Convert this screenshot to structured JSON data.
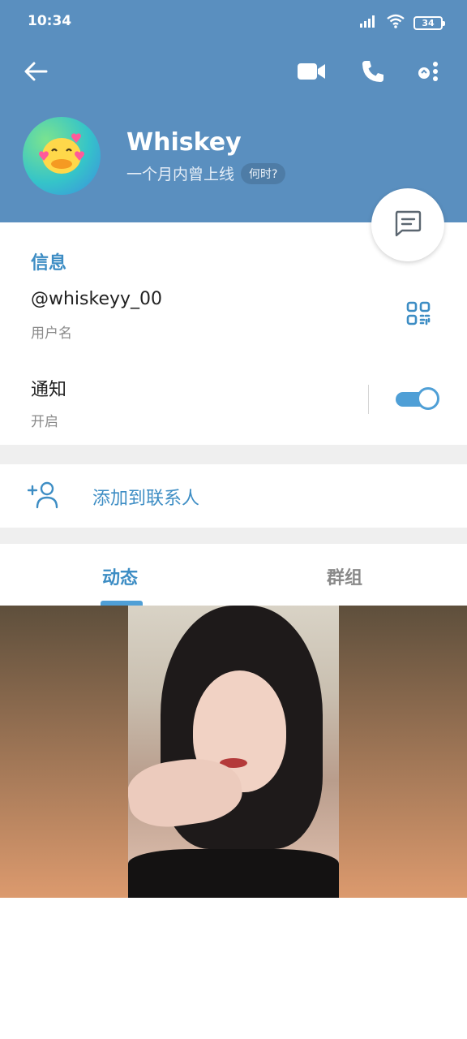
{
  "status_bar": {
    "time": "10:34",
    "battery": "34"
  },
  "colors": {
    "header": "#5a8fbf",
    "accent": "#3d8dc4",
    "toggle_on": "#4f9fd6"
  },
  "toolbar": {
    "back_icon": "arrow-left-icon",
    "video_icon": "video-camera-icon",
    "call_icon": "phone-icon",
    "more_icon": "more-options-icon"
  },
  "profile": {
    "name": "Whiskey",
    "last_seen": "一个月内曾上线",
    "when_chip": "何时?",
    "avatar_icon": "smiling-duck-emoji"
  },
  "info": {
    "section_title": "信息",
    "username": "@whiskeyy_00",
    "username_label": "用户名",
    "notifications": "通知",
    "notifications_state": "开启",
    "notifications_enabled": true
  },
  "add_contact": {
    "label": "添加到联系人",
    "icon": "add-person-icon"
  },
  "tabs": [
    {
      "label": "动态",
      "selected": true
    },
    {
      "label": "群组",
      "selected": false
    }
  ]
}
